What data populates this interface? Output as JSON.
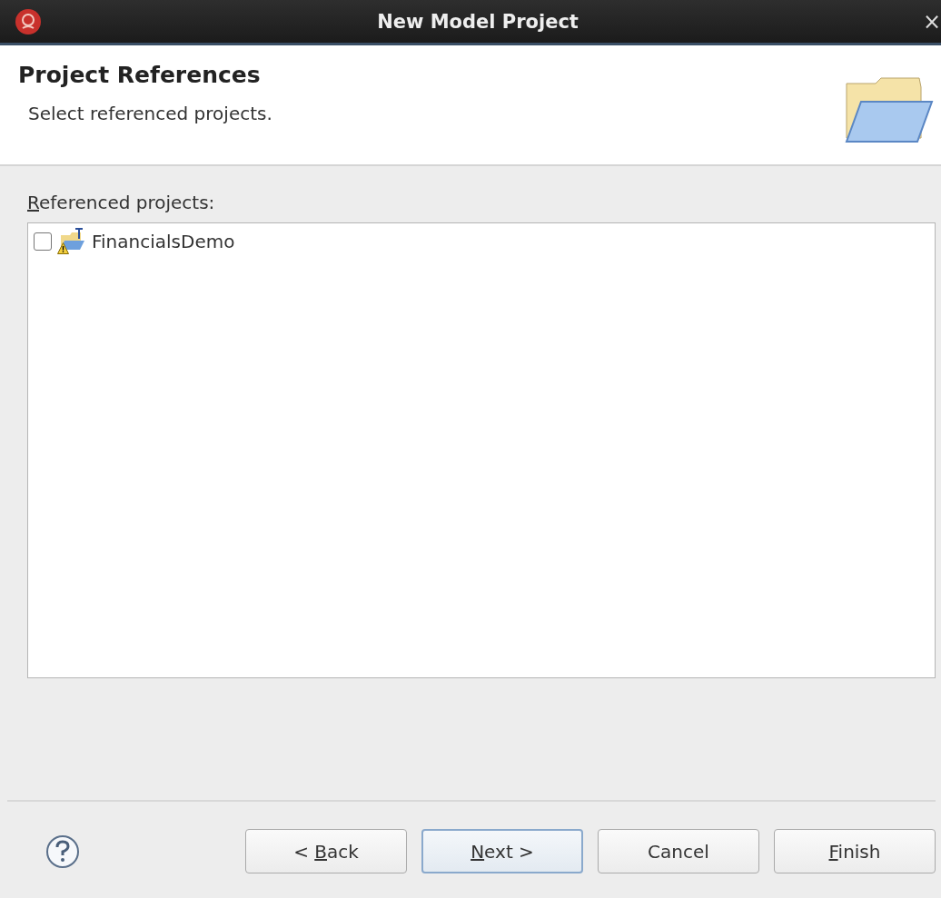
{
  "window": {
    "title": "New Model Project",
    "close": "×"
  },
  "header": {
    "title": "Project References",
    "description": "Select referenced projects."
  },
  "references": {
    "label": {
      "key": "R",
      "rest": "eferenced projects:"
    },
    "items": [
      {
        "name": "FinancialsDemo",
        "checked": false,
        "warning": true
      }
    ]
  },
  "buttons": [
    {
      "pre": "< ",
      "key": "B",
      "rest": "ack",
      "default": false
    },
    {
      "key": "N",
      "rest": "ext >",
      "default": true
    },
    {
      "rest": "Cancel",
      "default": false
    },
    {
      "key": "F",
      "rest": "inish",
      "default": false
    }
  ]
}
